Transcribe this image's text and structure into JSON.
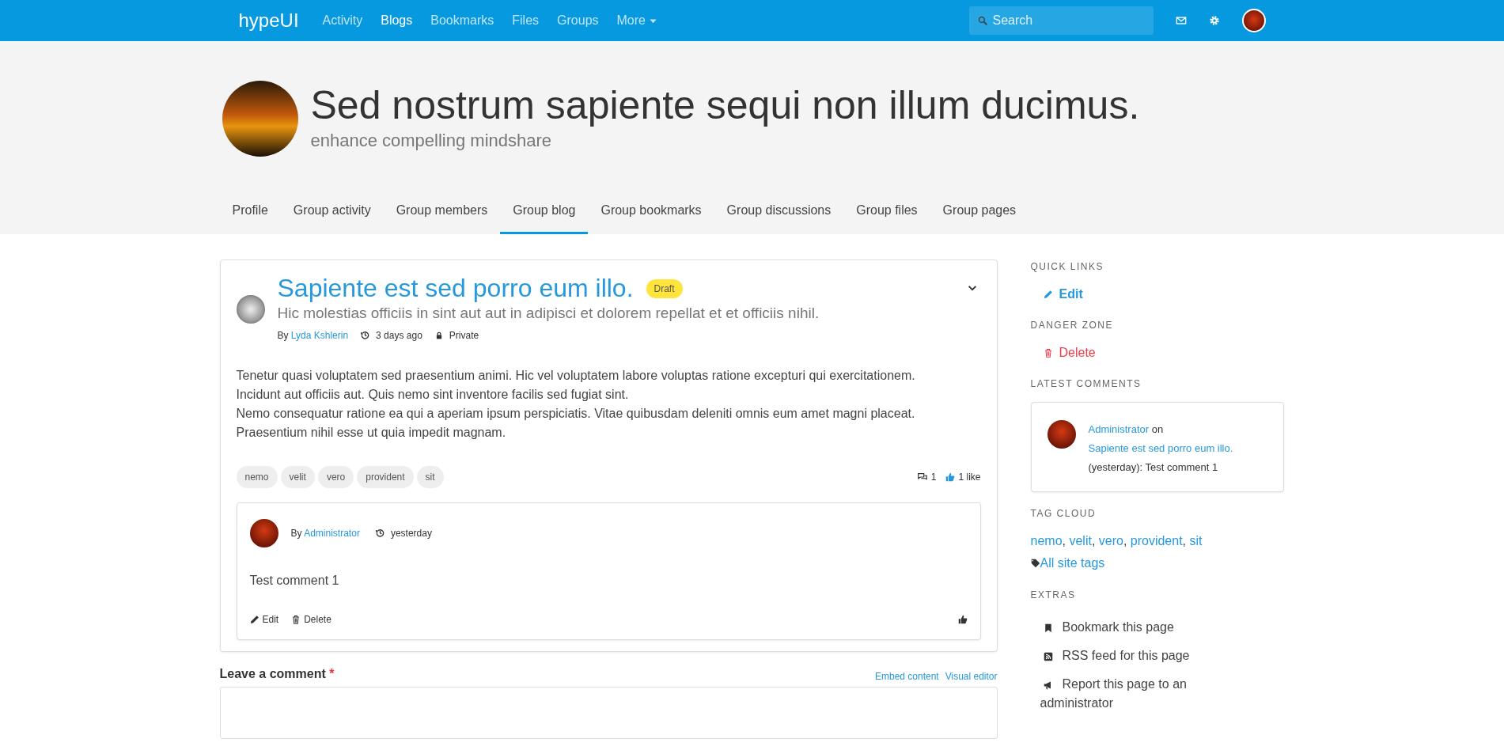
{
  "navbar": {
    "brand": "hypeUI",
    "items": [
      {
        "label": "Activity",
        "selected": false
      },
      {
        "label": "Blogs",
        "selected": true
      },
      {
        "label": "Bookmarks",
        "selected": false
      },
      {
        "label": "Files",
        "selected": false
      },
      {
        "label": "Groups",
        "selected": false
      }
    ],
    "more": {
      "label": "More"
    },
    "search": {
      "placeholder": "Search"
    }
  },
  "header": {
    "title": "Sed nostrum sapiente sequi non illum ducimus.",
    "subtitle": "enhance compelling mindshare"
  },
  "tabs": [
    {
      "label": "Profile",
      "selected": false
    },
    {
      "label": "Group activity",
      "selected": false
    },
    {
      "label": "Group members",
      "selected": false
    },
    {
      "label": "Group blog",
      "selected": true
    },
    {
      "label": "Group bookmarks",
      "selected": false
    },
    {
      "label": "Group discussions",
      "selected": false
    },
    {
      "label": "Group files",
      "selected": false
    },
    {
      "label": "Group pages",
      "selected": false
    }
  ],
  "post": {
    "title": "Sapiente est sed porro eum illo.",
    "badge": "Draft",
    "subtitle": "Hic molestias officiis in sint aut aut in adipisci et dolorem repellat et et officiis nihil.",
    "meta": {
      "by": "By",
      "author": "Lyda Kshlerin",
      "time": "3 days ago",
      "access": "Private"
    },
    "body": [
      "Tenetur quasi voluptatem sed praesentium animi. Hic vel voluptatem labore voluptas ratione excepturi qui exercitationem.",
      "Incidunt aut officiis aut. Quis nemo sint inventore facilis sed fugiat sint.",
      "Nemo consequatur ratione ea qui a aperiam ipsum perspiciatis. Vitae quibusdam deleniti omnis eum amet magni placeat.",
      "Praesentium nihil esse ut quia impedit magnam."
    ],
    "tags": [
      "nemo",
      "velit",
      "vero",
      "provident",
      "sit"
    ],
    "comments_count": "1",
    "likes": {
      "label": "1 like",
      "liked": true
    }
  },
  "comment": {
    "by": "By",
    "author": "Administrator",
    "time": "yesterday",
    "text": "Test comment 1",
    "actions": [
      {
        "kind": "edit",
        "label": "Edit"
      },
      {
        "kind": "delete",
        "label": "Delete"
      }
    ],
    "liked": false
  },
  "comment_form": {
    "label": "Leave a comment",
    "required": "*",
    "links": [
      "Embed content",
      "Visual editor"
    ]
  },
  "sidebar": [
    {
      "kind": "action",
      "heading": "QUICK LINKS",
      "item": {
        "kind": "edit",
        "label": "Edit"
      }
    },
    {
      "kind": "action",
      "heading": "DANGER ZONE",
      "item": {
        "kind": "delete",
        "label": "Delete"
      }
    },
    {
      "kind": "comments",
      "heading": "LATEST COMMENTS",
      "comment": {
        "author": "Administrator",
        "on": "on",
        "post": "Sapiente est sed porro eum illo.",
        "rest": "(yesterday): Test comment 1"
      }
    },
    {
      "kind": "tags",
      "heading": "TAG CLOUD",
      "tags": [
        "nemo",
        "velit",
        "vero",
        "provident",
        "sit"
      ],
      "separator": ",",
      "all_link": "All site tags"
    },
    {
      "kind": "extras",
      "heading": "EXTRAS",
      "items": [
        {
          "kind": "bookmark",
          "label": "Bookmark this page"
        },
        {
          "kind": "rss",
          "label": "RSS feed for this page"
        },
        {
          "kind": "report",
          "label": "Report this page to an administrator"
        }
      ]
    }
  ]
}
